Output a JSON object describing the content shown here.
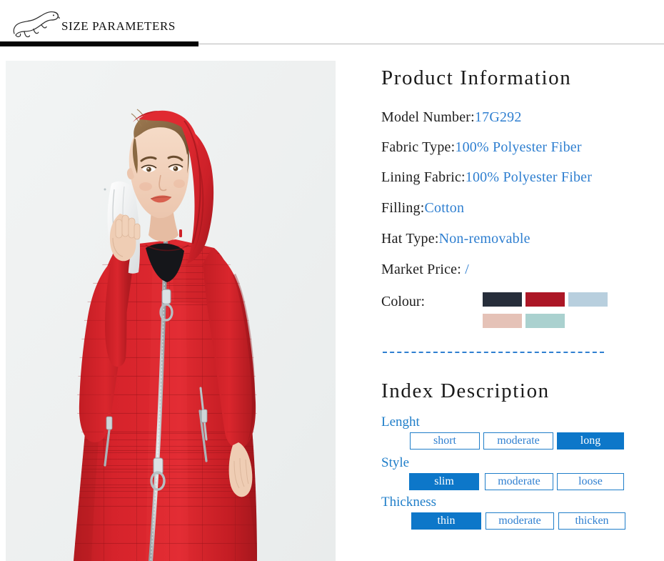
{
  "header": {
    "title": "SIZE PARAMETERS",
    "logo_icon": "polar-bear-logo-icon"
  },
  "product_image": {
    "alt": "Woman wearing long red hooded quilted coat",
    "background_color": "#eff1f1",
    "coat_color": "#d6232b"
  },
  "product_information": {
    "title": "Product Information",
    "specs": [
      {
        "label": "Model Number:",
        "value": "17G292"
      },
      {
        "label": "Fabric Type:",
        "value": "100% Polyester Fiber"
      },
      {
        "label": "Lining Fabric:",
        "value": "100% Polyester Fiber"
      },
      {
        "label": "Filling:",
        "value": "Cotton"
      },
      {
        "label": "Hat Type:",
        "value": "Non-removable"
      },
      {
        "label": "Market Price:",
        "value": " /"
      }
    ],
    "colour": {
      "label": "Colour:",
      "rows": [
        [
          "#272e3b",
          "#ac1726",
          "#b8cfde"
        ],
        [
          "#e5c2b7",
          "#aad1cf"
        ]
      ]
    }
  },
  "index_description": {
    "title": "Index Description",
    "accent_color": "#0d77c9",
    "groups": [
      {
        "label": "Lenght",
        "options": [
          {
            "text": "short",
            "active": false
          },
          {
            "text": "moderate",
            "active": false
          },
          {
            "text": "long",
            "active": true
          }
        ]
      },
      {
        "label": "Style",
        "options": [
          {
            "text": "slim",
            "active": true
          },
          {
            "text": "moderate",
            "active": false
          },
          {
            "text": "loose",
            "active": false
          }
        ]
      },
      {
        "label": "Thickness",
        "options": [
          {
            "text": "thin",
            "active": true
          },
          {
            "text": "moderate",
            "active": false
          },
          {
            "text": "thicken",
            "active": false
          }
        ]
      }
    ]
  }
}
